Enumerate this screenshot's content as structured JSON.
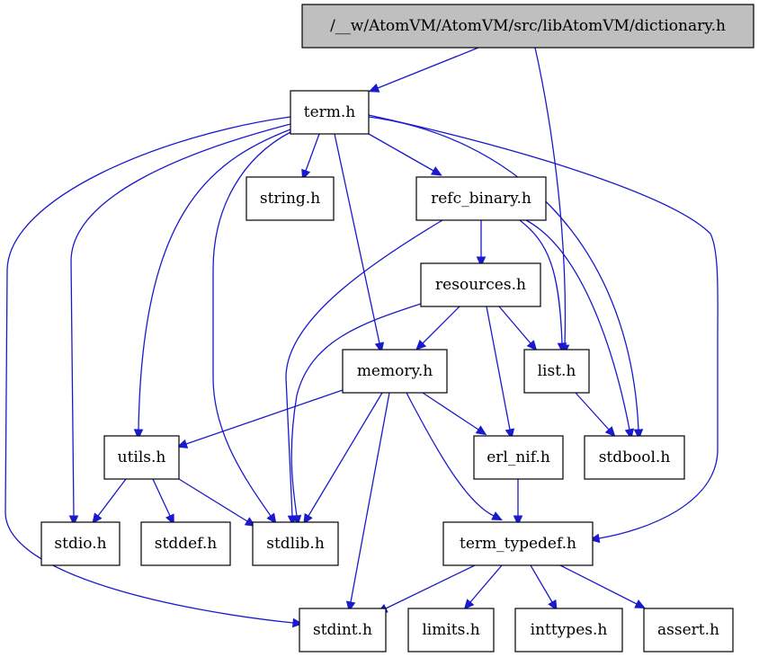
{
  "title": "/__w/AtomVM/AtomVM/src/libAtomVM/dictionary.h",
  "colors": {
    "edge": "#1a1acd",
    "root_fill": "#bfbfbf",
    "node_fill": "#ffffff",
    "node_border": "#000000"
  },
  "nodes": [
    {
      "id": "dictionary",
      "label": "/__w/AtomVM/AtomVM/src/libAtomVM/dictionary.h",
      "root": true
    },
    {
      "id": "term",
      "label": "term.h"
    },
    {
      "id": "string",
      "label": "string.h"
    },
    {
      "id": "refc_binary",
      "label": "refc_binary.h"
    },
    {
      "id": "resources",
      "label": "resources.h"
    },
    {
      "id": "memory",
      "label": "memory.h"
    },
    {
      "id": "list",
      "label": "list.h"
    },
    {
      "id": "utils",
      "label": "utils.h"
    },
    {
      "id": "erl_nif",
      "label": "erl_nif.h"
    },
    {
      "id": "stdbool",
      "label": "stdbool.h"
    },
    {
      "id": "stdio",
      "label": "stdio.h"
    },
    {
      "id": "stddef",
      "label": "stddef.h"
    },
    {
      "id": "stdlib",
      "label": "stdlib.h"
    },
    {
      "id": "term_typedef",
      "label": "term_typedef.h"
    },
    {
      "id": "stdint",
      "label": "stdint.h"
    },
    {
      "id": "limits",
      "label": "limits.h"
    },
    {
      "id": "inttypes",
      "label": "inttypes.h"
    },
    {
      "id": "assert",
      "label": "assert.h"
    }
  ],
  "edges": [
    {
      "from": "dictionary",
      "to": "term"
    },
    {
      "from": "dictionary",
      "to": "list"
    },
    {
      "from": "term",
      "to": "string"
    },
    {
      "from": "term",
      "to": "refc_binary"
    },
    {
      "from": "term",
      "to": "memory"
    },
    {
      "from": "term",
      "to": "utils"
    },
    {
      "from": "term",
      "to": "stdio"
    },
    {
      "from": "term",
      "to": "stdlib"
    },
    {
      "from": "term",
      "to": "stdint"
    },
    {
      "from": "term",
      "to": "stdbool"
    },
    {
      "from": "term",
      "to": "term_typedef"
    },
    {
      "from": "refc_binary",
      "to": "resources"
    },
    {
      "from": "refc_binary",
      "to": "list"
    },
    {
      "from": "refc_binary",
      "to": "stdbool"
    },
    {
      "from": "refc_binary",
      "to": "stdlib"
    },
    {
      "from": "resources",
      "to": "memory"
    },
    {
      "from": "resources",
      "to": "list"
    },
    {
      "from": "resources",
      "to": "erl_nif"
    },
    {
      "from": "resources",
      "to": "stdlib"
    },
    {
      "from": "memory",
      "to": "utils"
    },
    {
      "from": "memory",
      "to": "erl_nif"
    },
    {
      "from": "memory",
      "to": "term_typedef"
    },
    {
      "from": "memory",
      "to": "stdlib"
    },
    {
      "from": "memory",
      "to": "stdint"
    },
    {
      "from": "list",
      "to": "stdbool"
    },
    {
      "from": "utils",
      "to": "stdio"
    },
    {
      "from": "utils",
      "to": "stddef"
    },
    {
      "from": "utils",
      "to": "stdlib"
    },
    {
      "from": "erl_nif",
      "to": "term_typedef"
    },
    {
      "from": "term_typedef",
      "to": "stdint"
    },
    {
      "from": "term_typedef",
      "to": "limits"
    },
    {
      "from": "term_typedef",
      "to": "inttypes"
    },
    {
      "from": "term_typedef",
      "to": "assert"
    }
  ]
}
